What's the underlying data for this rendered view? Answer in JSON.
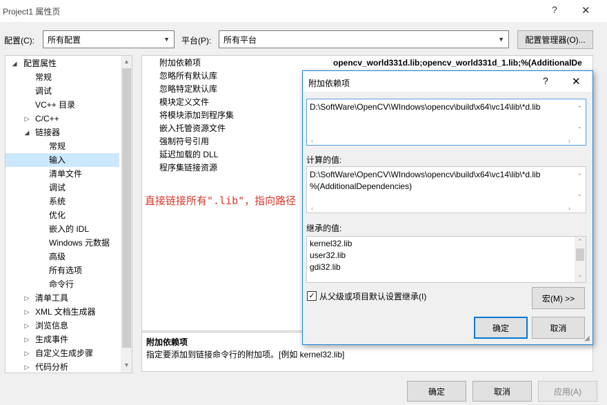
{
  "window": {
    "title": "Project1 属性页",
    "help_icon": "?",
    "close_icon": "✕"
  },
  "toolbar": {
    "config_label": "配置(C):",
    "config_value": "所有配置",
    "platform_label": "平台(P):",
    "platform_value": "所有平台",
    "config_manager_button": "配置管理器(O)..."
  },
  "tree": {
    "items": [
      {
        "label": "配置属性",
        "expander": "◢",
        "level": 0
      },
      {
        "label": "常规",
        "expander": "",
        "level": 1
      },
      {
        "label": "调试",
        "expander": "",
        "level": 1
      },
      {
        "label": "VC++ 目录",
        "expander": "",
        "level": 1
      },
      {
        "label": "C/C++",
        "expander": "▷",
        "level": 1
      },
      {
        "label": "链接器",
        "expander": "◢",
        "level": 1
      },
      {
        "label": "常规",
        "expander": "",
        "level": 2
      },
      {
        "label": "输入",
        "expander": "",
        "level": 2,
        "selected": true
      },
      {
        "label": "清单文件",
        "expander": "",
        "level": 2
      },
      {
        "label": "调试",
        "expander": "",
        "level": 2
      },
      {
        "label": "系统",
        "expander": "",
        "level": 2
      },
      {
        "label": "优化",
        "expander": "",
        "level": 2
      },
      {
        "label": "嵌入的 IDL",
        "expander": "",
        "level": 2
      },
      {
        "label": "Windows 元数据",
        "expander": "",
        "level": 2
      },
      {
        "label": "高级",
        "expander": "",
        "level": 2
      },
      {
        "label": "所有选项",
        "expander": "",
        "level": 2
      },
      {
        "label": "命令行",
        "expander": "",
        "level": 2
      },
      {
        "label": "清单工具",
        "expander": "▷",
        "level": 1
      },
      {
        "label": "XML 文档生成器",
        "expander": "▷",
        "level": 1
      },
      {
        "label": "浏览信息",
        "expander": "▷",
        "level": 1
      },
      {
        "label": "生成事件",
        "expander": "▷",
        "level": 1
      },
      {
        "label": "自定义生成步骤",
        "expander": "▷",
        "level": 1
      },
      {
        "label": "代码分析",
        "expander": "▷",
        "level": 1
      }
    ]
  },
  "grid": {
    "rows": [
      {
        "name": "附加依赖项",
        "value": "opencv_world331d.lib;opencv_world331d_1.lib;%(AdditionalDe"
      },
      {
        "name": "忽略所有默认库",
        "value": ""
      },
      {
        "name": "忽略特定默认库",
        "value": ""
      },
      {
        "name": "模块定义文件",
        "value": ""
      },
      {
        "name": "将模块添加到程序集",
        "value": ""
      },
      {
        "name": "嵌入托管资源文件",
        "value": ""
      },
      {
        "name": "强制符号引用",
        "value": ""
      },
      {
        "name": "延迟加载的 DLL",
        "value": ""
      },
      {
        "name": "程序集链接资源",
        "value": ""
      }
    ]
  },
  "annotation": "直接链接所有\".lib\"，指向路径",
  "description": {
    "title": "附加依赖项",
    "text": "指定要添加到链接命令行的附加项。[例如 kernel32.lib]"
  },
  "footer": {
    "ok": "确定",
    "cancel": "取消",
    "apply": "应用(A)"
  },
  "dialog": {
    "title": "附加依赖项",
    "help_icon": "?",
    "close_icon": "✕",
    "edit_value": "D:\\SoftWare\\OpenCV\\WIndows\\opencv\\build\\x64\\vc14\\lib\\*d.lib",
    "computed_label": "计算的值:",
    "computed_lines": [
      "D:\\SoftWare\\OpenCV\\WIndows\\opencv\\build\\x64\\vc14\\lib\\*d.lib",
      "%(AdditionalDependencies)"
    ],
    "inherited_label": "继承的值:",
    "inherited_lines": [
      "kernel32.lib",
      "user32.lib",
      "gdi32.lib"
    ],
    "inherit_checkbox": "从父级或项目默认设置继承(I)",
    "inherit_checked": true,
    "macro_button": "宏(M) >>",
    "ok": "确定",
    "cancel": "取消"
  }
}
